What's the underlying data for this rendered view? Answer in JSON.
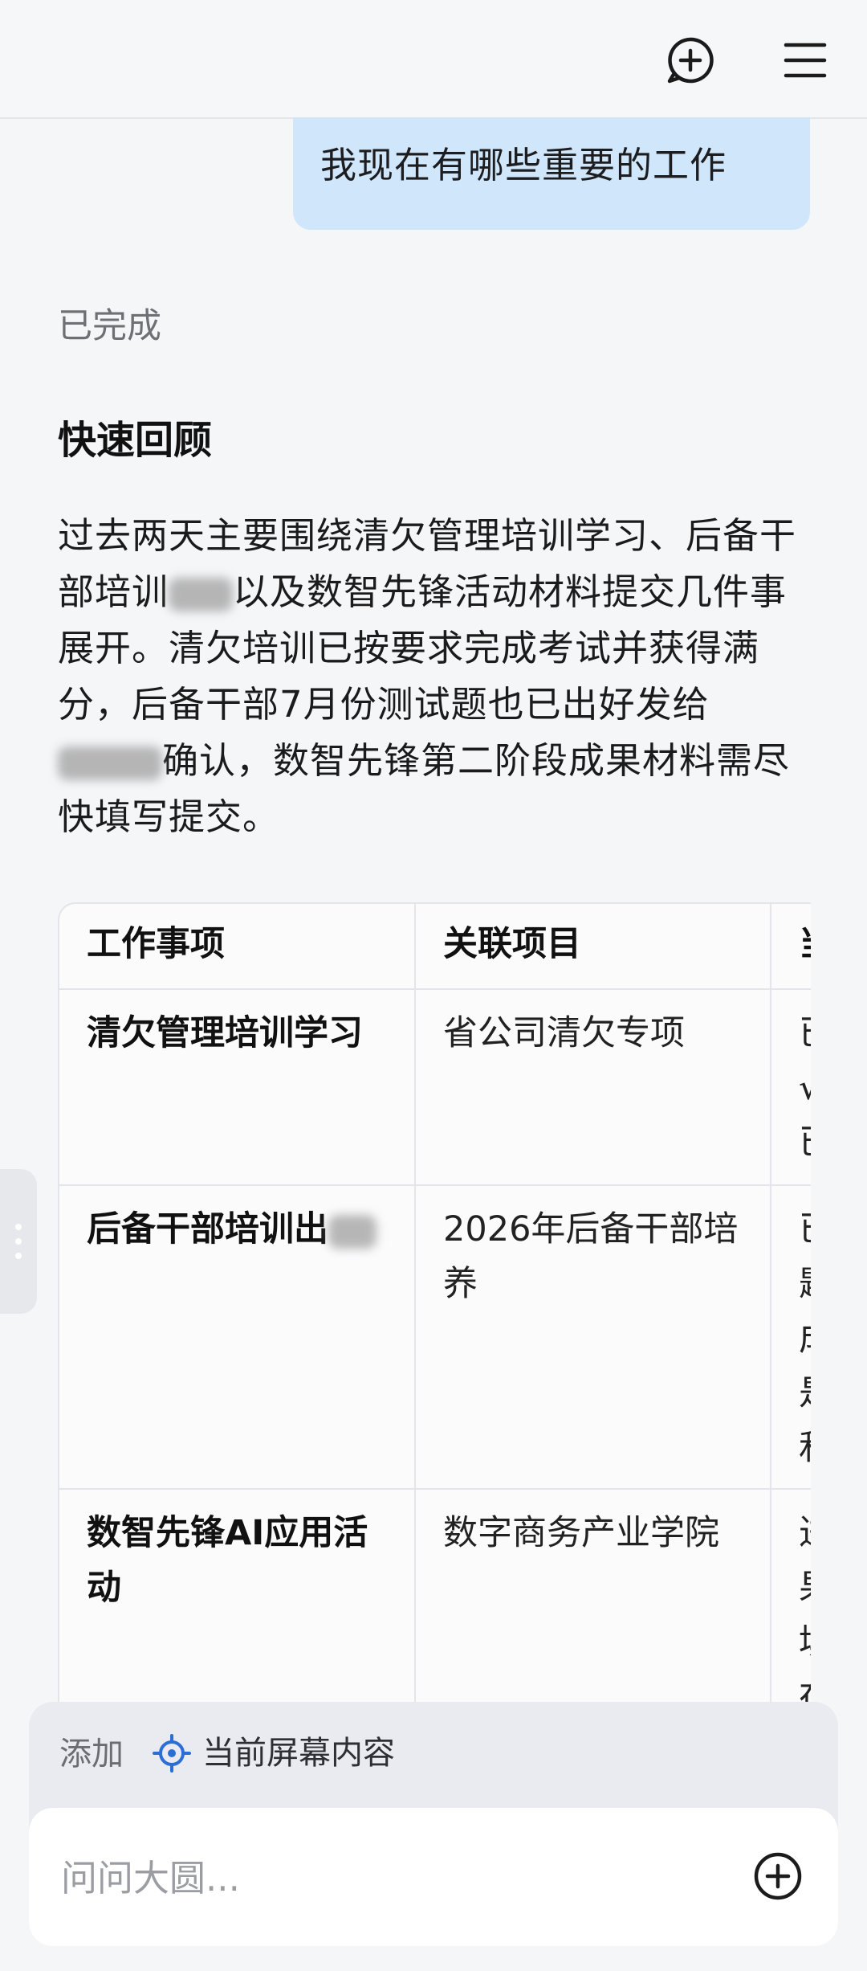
{
  "header": {
    "new_chat_icon": "add-chat-icon",
    "menu_icon": "hamburger-menu-icon"
  },
  "conversation": {
    "user_message": "我现在有哪些重要的工作",
    "status": "已完成",
    "section_title": "快速回顾",
    "summary_part1": "过去两天主要围绕清欠管理培训学习、后备干部培训",
    "summary_part2": "以及数智先锋活动材料提交几件事展开。清欠培训已按要求完成考试并获得满分，后备干部7月份测试题也已出好发给",
    "summary_part3": "确认，数智先锋第二阶段成果材料需尽快填写提交。"
  },
  "table": {
    "headers": [
      "工作事项",
      "关联项目",
      "当"
    ],
    "rows": [
      {
        "item": "清欠管理培训学习",
        "project": "省公司清欠专项",
        "clipped": "已\n√\n已"
      },
      {
        "item": "后备干部培训出",
        "project": "2026年后备干部培养",
        "clipped": "已\n题\n成\n是\n和"
      },
      {
        "item": "数智先锋AI应用活动",
        "project": "数字商务产业学院",
        "clipped": "进\n果\n填\n在"
      }
    ]
  },
  "composer": {
    "add_label": "添加",
    "screen_chip_label": "当前屏幕内容",
    "input_placeholder": "问问大圆...",
    "input_value": ""
  },
  "colors": {
    "user_bubble": "#cfe6fb",
    "background": "#f5f6f8",
    "accent_blue": "#2b6fd6"
  }
}
